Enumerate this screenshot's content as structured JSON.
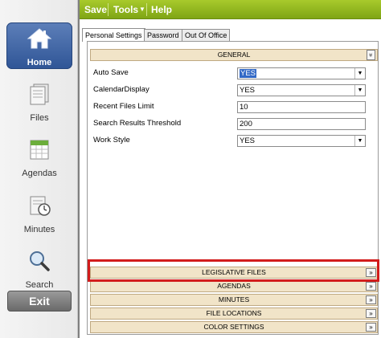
{
  "sidebar": {
    "items": [
      {
        "label": "Home",
        "icon": "home-icon"
      },
      {
        "label": "Files",
        "icon": "files-icon"
      },
      {
        "label": "Agendas",
        "icon": "agendas-icon"
      },
      {
        "label": "Minutes",
        "icon": "minutes-icon"
      },
      {
        "label": "Search",
        "icon": "search-icon"
      }
    ],
    "exit_label": "Exit"
  },
  "menubar": {
    "save": "Save",
    "tools": "Tools",
    "tools_arrow": "▼",
    "help": "Help"
  },
  "tabs": [
    "Personal Settings",
    "Password",
    "Out Of Office"
  ],
  "general": {
    "title": "GENERAL",
    "collapse_glyph": "»",
    "fields": [
      {
        "label": "Auto Save",
        "value": "YES"
      },
      {
        "label": "CalendarDisplay",
        "value": "YES"
      },
      {
        "label": "Recent Files Limit",
        "value": "10"
      },
      {
        "label": "Search Results Threshold",
        "value": "200"
      },
      {
        "label": "Work Style",
        "value": "YES"
      }
    ]
  },
  "sections": [
    {
      "title": "LEGISLATIVE FILES",
      "glyph": "»"
    },
    {
      "title": "AGENDAS",
      "glyph": "»"
    },
    {
      "title": "MINUTES",
      "glyph": "»"
    },
    {
      "title": "FILE LOCATIONS",
      "glyph": "»"
    },
    {
      "title": "COLOR SETTINGS",
      "glyph": "»"
    }
  ],
  "colors": {
    "menubar": "#8fb81f",
    "active_nav": "#3a5fa0",
    "highlight": "#d21c1c",
    "section": "#f1e4c8"
  }
}
